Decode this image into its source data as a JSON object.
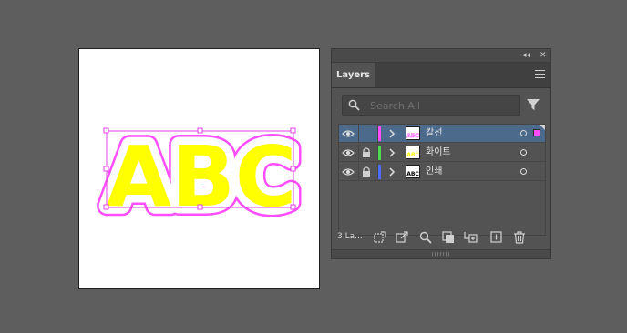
{
  "panel": {
    "tab_label": "Layers",
    "collapse_glyph": "◂◂",
    "close_glyph": "✕",
    "search_placeholder": "Search All",
    "layer_count": "3 La...",
    "layers": [
      {
        "name": "칼선",
        "color": "#ff4dff",
        "selected": true,
        "locked": false
      },
      {
        "name": "화이트",
        "color": "#4ddc4d",
        "selected": false,
        "locked": true
      },
      {
        "name": "인쇄",
        "color": "#4f6cff",
        "selected": false,
        "locked": true
      }
    ]
  },
  "artwork": {
    "text": "ABC",
    "fill_color": "#ffff00",
    "cutline_color": "#ff4dff",
    "selection_color": "#e040e0"
  },
  "icons": {
    "search": "search-icon",
    "filter": "filter-icon",
    "visibility": "eye-icon",
    "lock": "lock-icon",
    "expand": "chevron-right-icon",
    "menu": "hamburger-menu-icon",
    "trash": "trash-icon"
  }
}
